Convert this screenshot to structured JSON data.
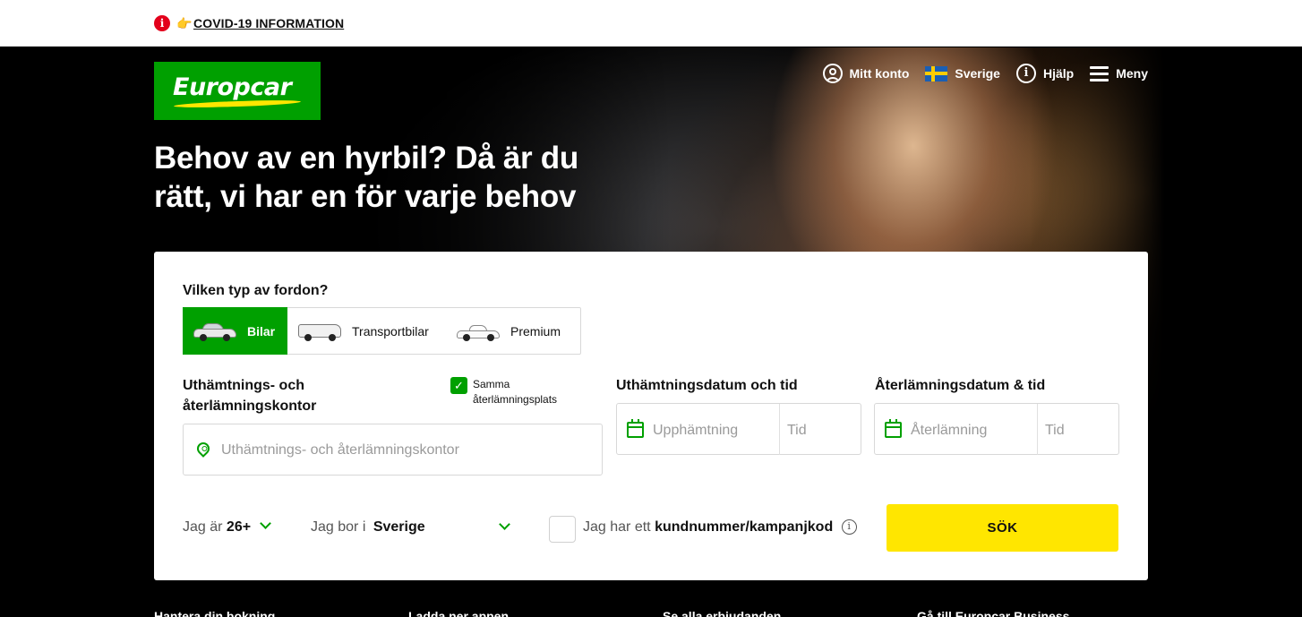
{
  "covid": {
    "label": "COVID-19 INFORMATION",
    "info_glyph": "i",
    "hand_glyph": "👉"
  },
  "brand": {
    "logo_text": "Europcar",
    "green": "#00a000",
    "yellow": "#ffe600"
  },
  "nav": {
    "account": "Mitt konto",
    "country": "Sverige",
    "help": "Hjälp",
    "help_glyph": "i",
    "menu": "Meny"
  },
  "hero": {
    "headline": "Behov av en hyrbil? Då är du rätt, vi har en för varje behov"
  },
  "booking": {
    "vehicle_question": "Vilken typ av fordon?",
    "vehicle_types": [
      {
        "label": "Bilar",
        "icon": "car-icon",
        "selected": true
      },
      {
        "label": "Transportbilar",
        "icon": "van-icon",
        "selected": false
      },
      {
        "label": "Premium",
        "icon": "premium-car-icon",
        "selected": false
      }
    ],
    "location_label": "Uthämtnings- och återlämningskontor",
    "same_return_label": "Samma återlämningsplats",
    "same_return_checked": true,
    "check_glyph": "✓",
    "location_placeholder": "Uthämtnings- och återlämningskontor",
    "pickup_label": "Uthämtningsdatum och tid",
    "pickup_date_placeholder": "Upphämtning",
    "pickup_time_placeholder": "Tid",
    "return_label": "Återlämningsdatum & tid",
    "return_date_placeholder": "Återlämning",
    "return_time_placeholder": "Tid",
    "age_prefix": "Jag är",
    "age_value": "26+",
    "residence_prefix": "Jag bor i",
    "residence_value": "Sverige",
    "promo_prefix": "Jag har ett",
    "promo_bold": "kundnummer/kampanjkod",
    "promo_info_glyph": "i",
    "search_label": "SÖK"
  },
  "footer_links": [
    "Hantera din bokning",
    "Ladda ner appen",
    "Se alla erbjudanden",
    "Gå till Europcar Business"
  ]
}
